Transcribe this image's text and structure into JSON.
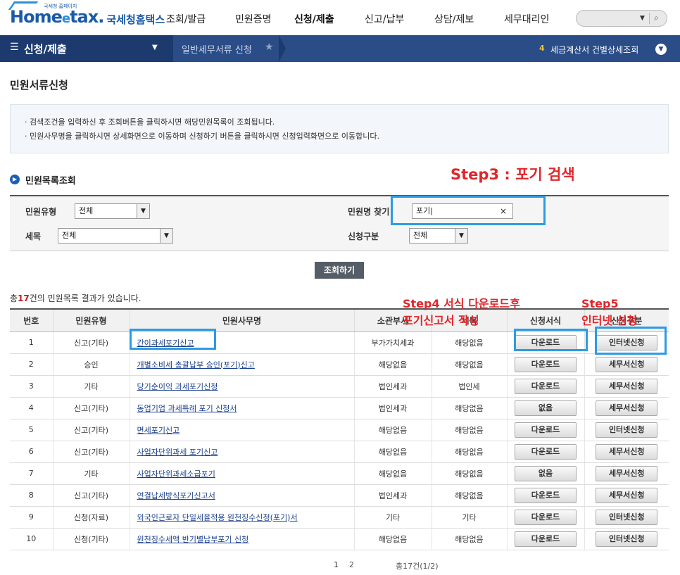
{
  "header": {
    "logo_main": "Home",
    "logo_e": "e",
    "logo_tax": "tax.",
    "logo_sub": "국세청홈택스",
    "logo_tiny": "국세청 홈페이지",
    "menus": [
      "조회/발급",
      "민원증명",
      "신청/제출",
      "신고/납부",
      "상담/제보",
      "세무대리인"
    ],
    "search_placeholder": ""
  },
  "navbar": {
    "menu_title": "신청/제출",
    "breadcrumb": "일반세무서류 신청",
    "notice_num": "4",
    "notice_text": "세금계산서 건별상세조회"
  },
  "page": {
    "title": "민원서류신청",
    "info_lines": [
      "· 검색조건을 입력하신 후 조회버튼을 클릭하시면 해당민원목록이 조회됩니다.",
      "· 민원사무명을 클릭하시면 상세화면으로 이동하며  신청하기 버튼을 클릭하시면 신청입력화면으로 이동합니다."
    ],
    "section_title": "민원목록조회"
  },
  "annotations": {
    "step3": "Step3 : 포기 검색",
    "step4_line1": "Step4 서식 다운로드후",
    "step4_line2": "포기신고서 작성",
    "step5_line1": "Step5",
    "step5_line2": "인터넷 신청"
  },
  "form": {
    "type_label": "민원유형",
    "type_value": "전체",
    "name_label": "민원명 찾기",
    "name_value": "포기|",
    "tax_label": "세목",
    "tax_value": "전체",
    "apply_label": "신청구분",
    "apply_value": "전체",
    "search_button": "조회하기"
  },
  "results": {
    "prefix": "총",
    "count": "17",
    "suffix": "건의 민원목록 결과가 있습니다."
  },
  "table": {
    "headers": [
      "번호",
      "민원유형",
      "민원사무명",
      "소관부서",
      "세목",
      "신청서식",
      "신청구분"
    ],
    "rows": [
      {
        "no": "1",
        "type": "신고(기타)",
        "name": "간이과세포기신고",
        "dept": "부가가치세과",
        "tax": "해당없음",
        "form": "다운로드",
        "apply": "인터넷신청"
      },
      {
        "no": "2",
        "type": "승인",
        "name": "개별소비세 총괄납부 승인(포기)신고",
        "dept": "해당없음",
        "tax": "해당없음",
        "form": "다운로드",
        "apply": "세무서신청"
      },
      {
        "no": "3",
        "type": "기타",
        "name": "당기순이익 과세포기신청",
        "dept": "법인세과",
        "tax": "법인세",
        "form": "다운로드",
        "apply": "세무서신청"
      },
      {
        "no": "4",
        "type": "신고(기타)",
        "name": "동업기업 과세특례 포기 신청서",
        "dept": "법인세과",
        "tax": "해당없음",
        "form": "없음",
        "apply": "세무서신청"
      },
      {
        "no": "5",
        "type": "신고(기타)",
        "name": "면세포기신고",
        "dept": "해당없음",
        "tax": "해당없음",
        "form": "다운로드",
        "apply": "인터넷신청"
      },
      {
        "no": "6",
        "type": "신고(기타)",
        "name": "사업자단위과세 포기신고",
        "dept": "해당없음",
        "tax": "해당없음",
        "form": "다운로드",
        "apply": "세무서신청"
      },
      {
        "no": "7",
        "type": "기타",
        "name": "사업자단위과세소급포기",
        "dept": "해당없음",
        "tax": "해당없음",
        "form": "없음",
        "apply": "세무서신청"
      },
      {
        "no": "8",
        "type": "신고(기타)",
        "name": "연결납세방식포기신고서",
        "dept": "법인세과",
        "tax": "해당없음",
        "form": "다운로드",
        "apply": "세무서신청"
      },
      {
        "no": "9",
        "type": "신청(자료)",
        "name": "외국인근로자 단일세율적용 원천징수신청(포기)서",
        "dept": "기타",
        "tax": "기타",
        "form": "다운로드",
        "apply": "인터넷신청"
      },
      {
        "no": "10",
        "type": "신청(기타)",
        "name": "원천징수세액 반기별납부포기 신청",
        "dept": "해당없음",
        "tax": "해당없음",
        "form": "다운로드",
        "apply": "인터넷신청"
      }
    ]
  },
  "pager": {
    "pages": [
      "1",
      "2"
    ],
    "summary": "총17건(1/2)"
  },
  "colors": {
    "navbar": "#2a4c87",
    "annotation": "#e0262b",
    "highlight": "#2d9be2"
  }
}
